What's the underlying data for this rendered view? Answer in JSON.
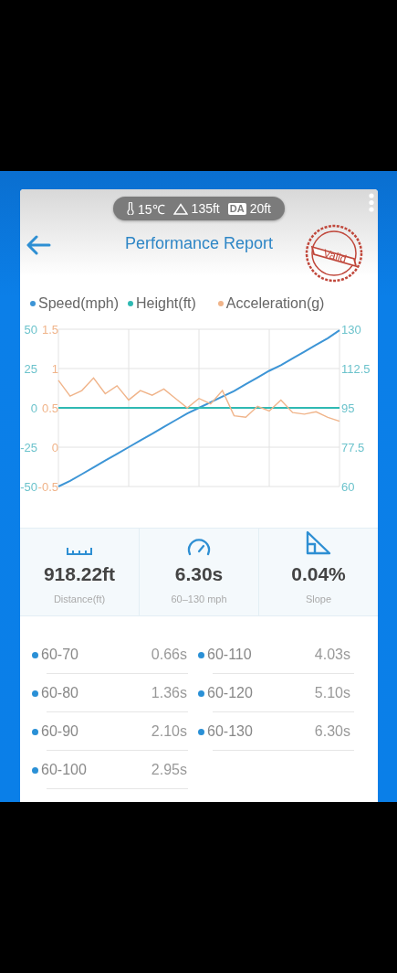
{
  "status_pill": {
    "temperature": "15℃",
    "elevation": "135ft",
    "da_label": "DA",
    "density_altitude": "20ft"
  },
  "header": {
    "title": "Performance Report",
    "stamp": "Valid"
  },
  "chart": {
    "chart_data": {
      "type": "line",
      "grid": true,
      "ylim": [
        60,
        130
      ],
      "yticks": [
        60,
        77.5,
        95,
        112.5,
        130
      ],
      "y2lim": [
        -50,
        50
      ],
      "y2ticks": [
        -50,
        -25,
        0,
        25,
        50
      ],
      "y3lim": [
        -0.5,
        1.5
      ],
      "y3ticks": [
        -0.5,
        0,
        0.5,
        1,
        1.5
      ],
      "series": [
        {
          "name": "Speed(mph)",
          "color": "#3d95d6",
          "values": [
            60,
            62.5,
            65.5,
            68.5,
            71.5,
            74.5,
            77.5,
            80.5,
            83.5,
            86.5,
            89.5,
            92.5,
            95,
            97.5,
            100,
            102.5,
            105.5,
            108.5,
            111.5,
            114,
            117,
            120,
            123,
            126,
            129.5
          ]
        },
        {
          "name": "Height(ft)",
          "color": "#2fb9b3",
          "axis": "y2",
          "values": [
            0,
            0,
            0,
            0,
            0,
            0,
            0,
            0,
            0,
            0,
            0,
            0,
            0,
            0,
            0,
            0,
            0,
            0,
            0,
            0,
            0,
            0,
            0,
            0,
            0
          ]
        },
        {
          "name": "Acceleration(g)",
          "color": "#f0b48a",
          "axis": "y3",
          "values": [
            0.85,
            0.65,
            0.72,
            0.88,
            0.68,
            0.78,
            0.6,
            0.72,
            0.66,
            0.74,
            0.62,
            0.5,
            0.62,
            0.55,
            0.72,
            0.4,
            0.38,
            0.52,
            0.46,
            0.6,
            0.44,
            0.42,
            0.45,
            0.38,
            0.33
          ]
        }
      ]
    }
  },
  "stats": [
    {
      "kind": "distance",
      "value": "918.22ft",
      "label": "Distance(ft)"
    },
    {
      "kind": "time",
      "value": "6.30s",
      "label": "60–130 mph"
    },
    {
      "kind": "slope",
      "value": "0.04%",
      "label": "Slope"
    }
  ],
  "splits": [
    {
      "range": "60-70",
      "time": "0.66s"
    },
    {
      "range": "60-80",
      "time": "1.36s"
    },
    {
      "range": "60-90",
      "time": "2.10s"
    },
    {
      "range": "60-100",
      "time": "2.95s"
    },
    {
      "range": "60-110",
      "time": "4.03s"
    },
    {
      "range": "60-120",
      "time": "5.10s"
    },
    {
      "range": "60-130",
      "time": "6.30s"
    }
  ]
}
